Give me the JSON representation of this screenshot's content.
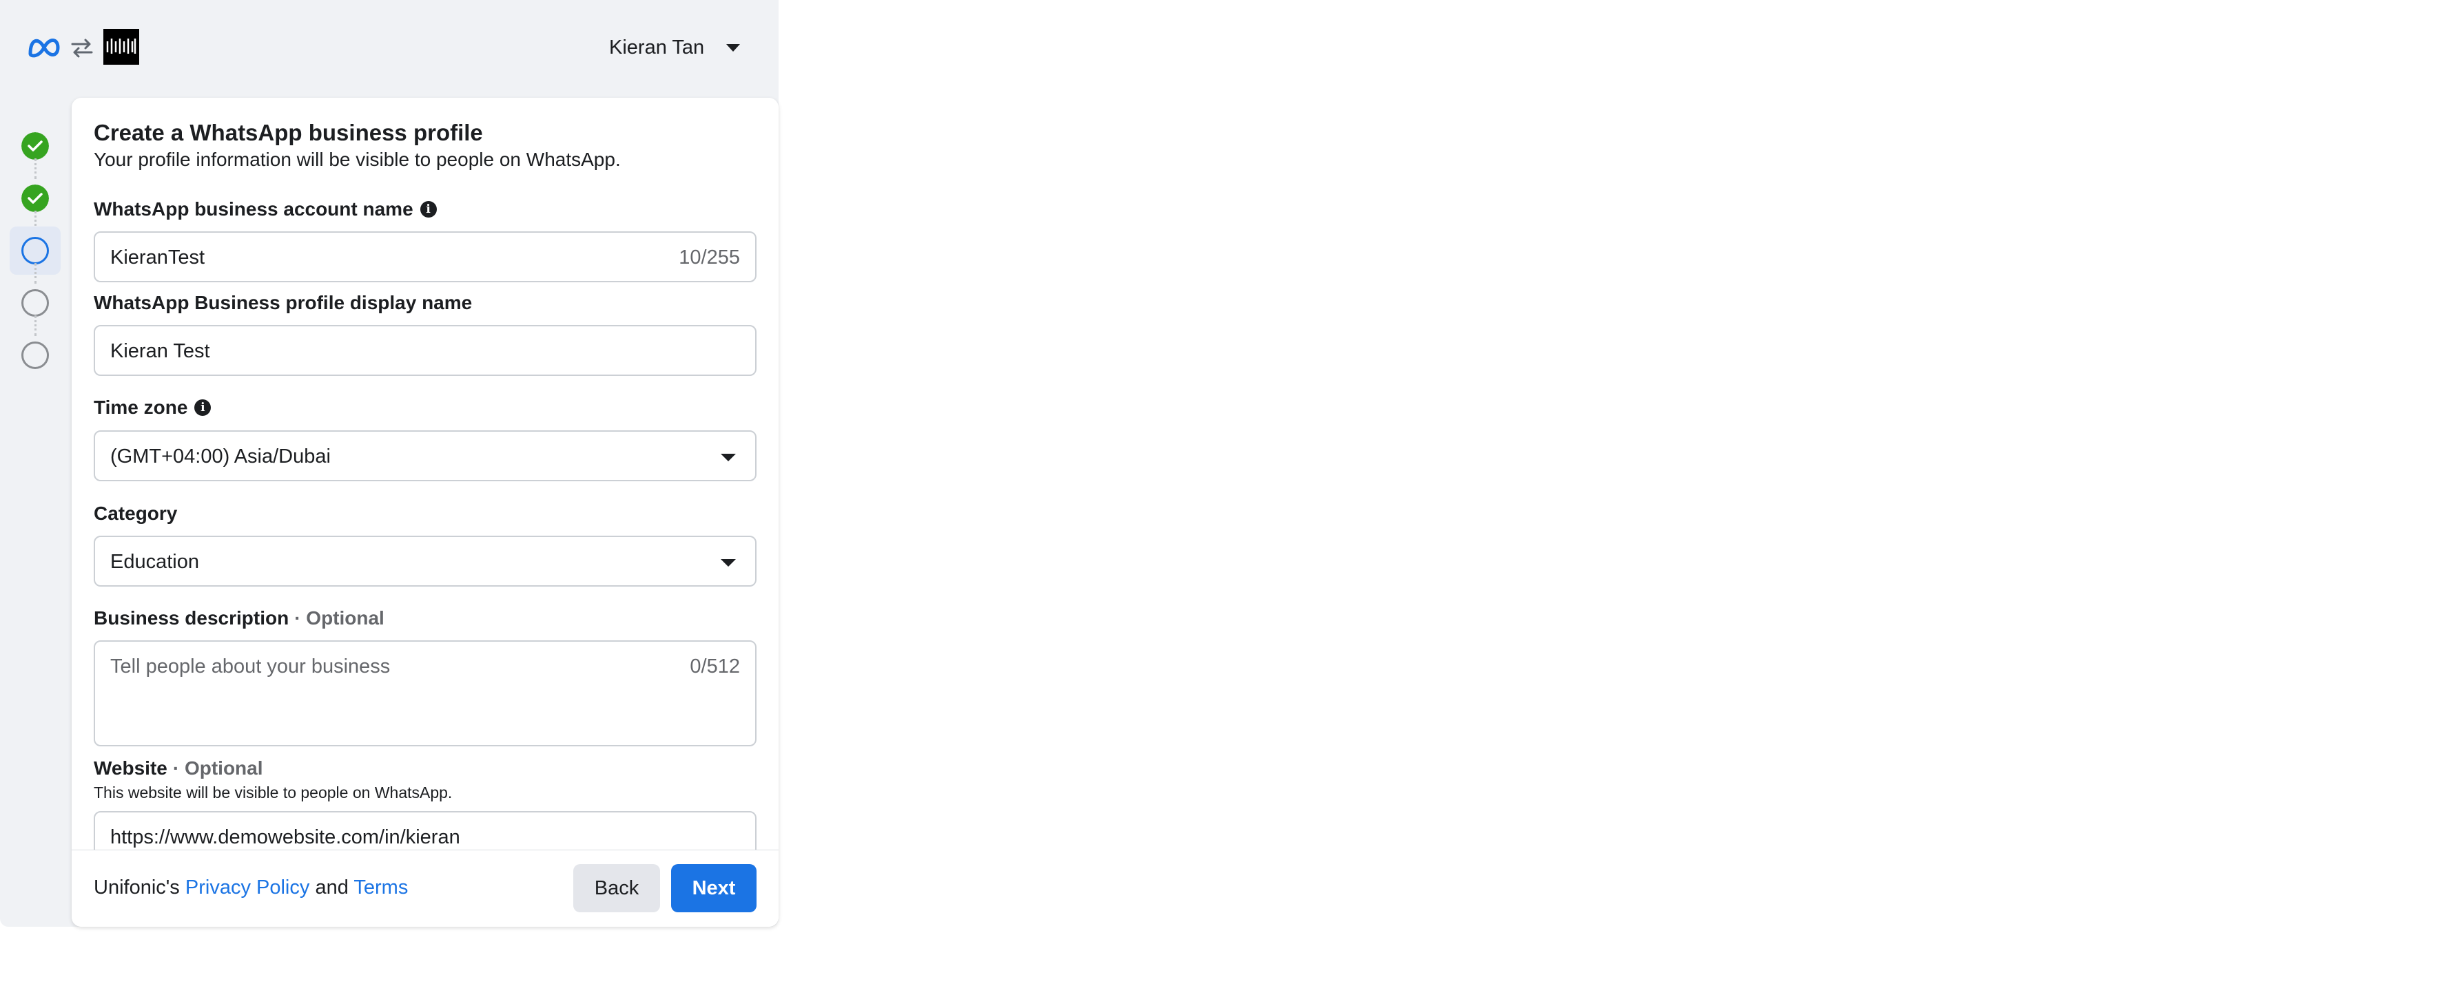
{
  "header": {
    "logo_icon": "meta-logo-icon",
    "swap_icon": "swap-arrows-icon",
    "brand_icon": "waveform-logo-icon",
    "user_name": "Kieran Tan"
  },
  "stepper": {
    "steps": [
      {
        "state": "done",
        "icon": "check-circle-icon"
      },
      {
        "state": "done",
        "icon": "check-circle-icon"
      },
      {
        "state": "current",
        "icon": "ring-icon"
      },
      {
        "state": "pending",
        "icon": "ring-icon"
      },
      {
        "state": "pending",
        "icon": "ring-icon"
      }
    ]
  },
  "form": {
    "title": "Create a WhatsApp business profile",
    "subtitle": "Your profile information will be visible to people on WhatsApp.",
    "account_name": {
      "label": "WhatsApp business account name",
      "value": "KieranTest",
      "count": "10/255"
    },
    "display_name": {
      "label": "WhatsApp Business profile display name",
      "value": "Kieran Test"
    },
    "time_zone": {
      "label": "Time zone",
      "value": "(GMT+04:00) Asia/Dubai"
    },
    "category": {
      "label": "Category",
      "value": "Education"
    },
    "description": {
      "label": "Business description",
      "optional": "· Optional",
      "placeholder": "Tell people about your business",
      "count": "0/512"
    },
    "website": {
      "label": "Website",
      "optional": "· Optional",
      "help": "This website will be visible to people on WhatsApp.",
      "value": "https://www.demowebsite.com/in/kieran"
    }
  },
  "footer": {
    "prefix": "Unifonic's",
    "privacy": "Privacy Policy",
    "and": "and",
    "terms": "Terms",
    "back": "Back",
    "next": "Next"
  },
  "colors": {
    "accent": "#1b74e4",
    "success": "#36a420",
    "panel_bg": "#f0f2f5"
  }
}
